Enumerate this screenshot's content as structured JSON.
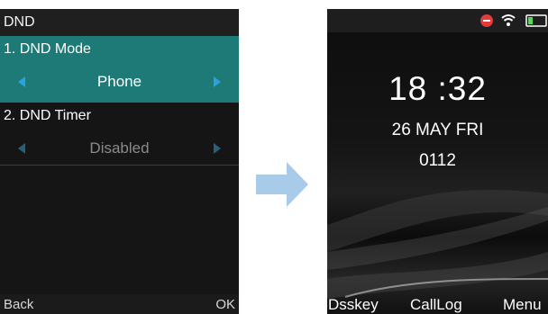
{
  "left_screen": {
    "title": "DND",
    "items": [
      {
        "label": "1. DND Mode",
        "value": "Phone",
        "selected": true
      },
      {
        "label": "2. DND Timer",
        "value": "Disabled",
        "selected": false
      }
    ],
    "softkeys": {
      "left": "Back",
      "right": "OK"
    },
    "colors": {
      "highlight": "#1d7a76",
      "arrow_active": "#29a3e0",
      "arrow_inactive": "#2a5f7a"
    }
  },
  "transition_arrow": {
    "icon": "arrow-right-icon",
    "color": "#a9cbea"
  },
  "right_screen": {
    "status_icons": [
      "dnd-icon",
      "wifi-icon",
      "battery-icon"
    ],
    "time": "18 :32",
    "date": "26 MAY FRI",
    "extension": "0112",
    "softkeys": [
      "Dsskey",
      "CallLog",
      "Menu"
    ]
  }
}
